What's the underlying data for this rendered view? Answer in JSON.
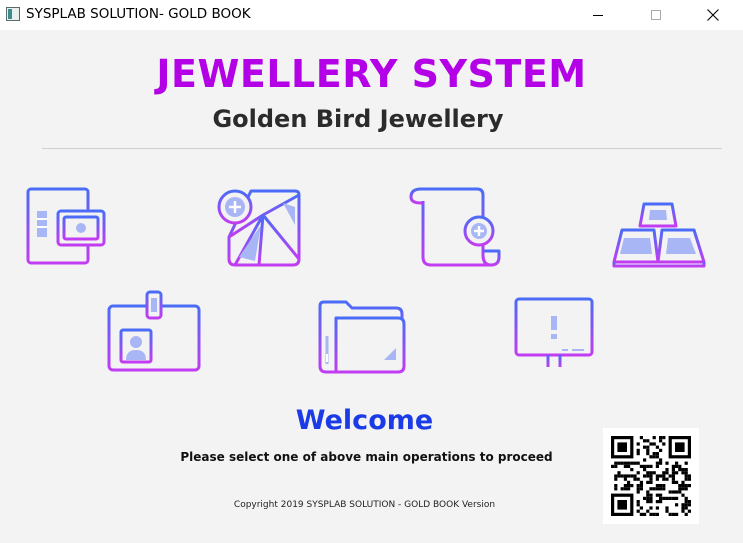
{
  "window": {
    "title": "SYSPLAB SOLUTION- GOLD BOOK",
    "minimize_glyph": "—",
    "maximize_glyph": "☐",
    "close_glyph": "✕"
  },
  "header": {
    "title": "JEWELLERY SYSTEM",
    "subtitle": "Golden Bird Jewellery"
  },
  "tiles": [
    {
      "icon": "invoice-cash-icon"
    },
    {
      "icon": "add-diamond-icon"
    },
    {
      "icon": "scroll-add-icon"
    },
    {
      "icon": "gold-bars-icon"
    },
    {
      "icon": "id-card-icon"
    },
    {
      "icon": "folder-icon"
    },
    {
      "icon": "monitor-alert-icon"
    }
  ],
  "welcome": {
    "heading": "Welcome",
    "instruction": "Please select one of above main operations to proceed"
  },
  "footer": {
    "copyright": "Copyright 2019 SYSPLAB SOLUTION - GOLD BOOK Version"
  },
  "colors": {
    "title": "#b400e6",
    "welcome": "#1a3be6",
    "icon_gradient_start": "#4a6cf7",
    "icon_gradient_end": "#c23cf2",
    "icon_fill": "#a9b6f5"
  }
}
